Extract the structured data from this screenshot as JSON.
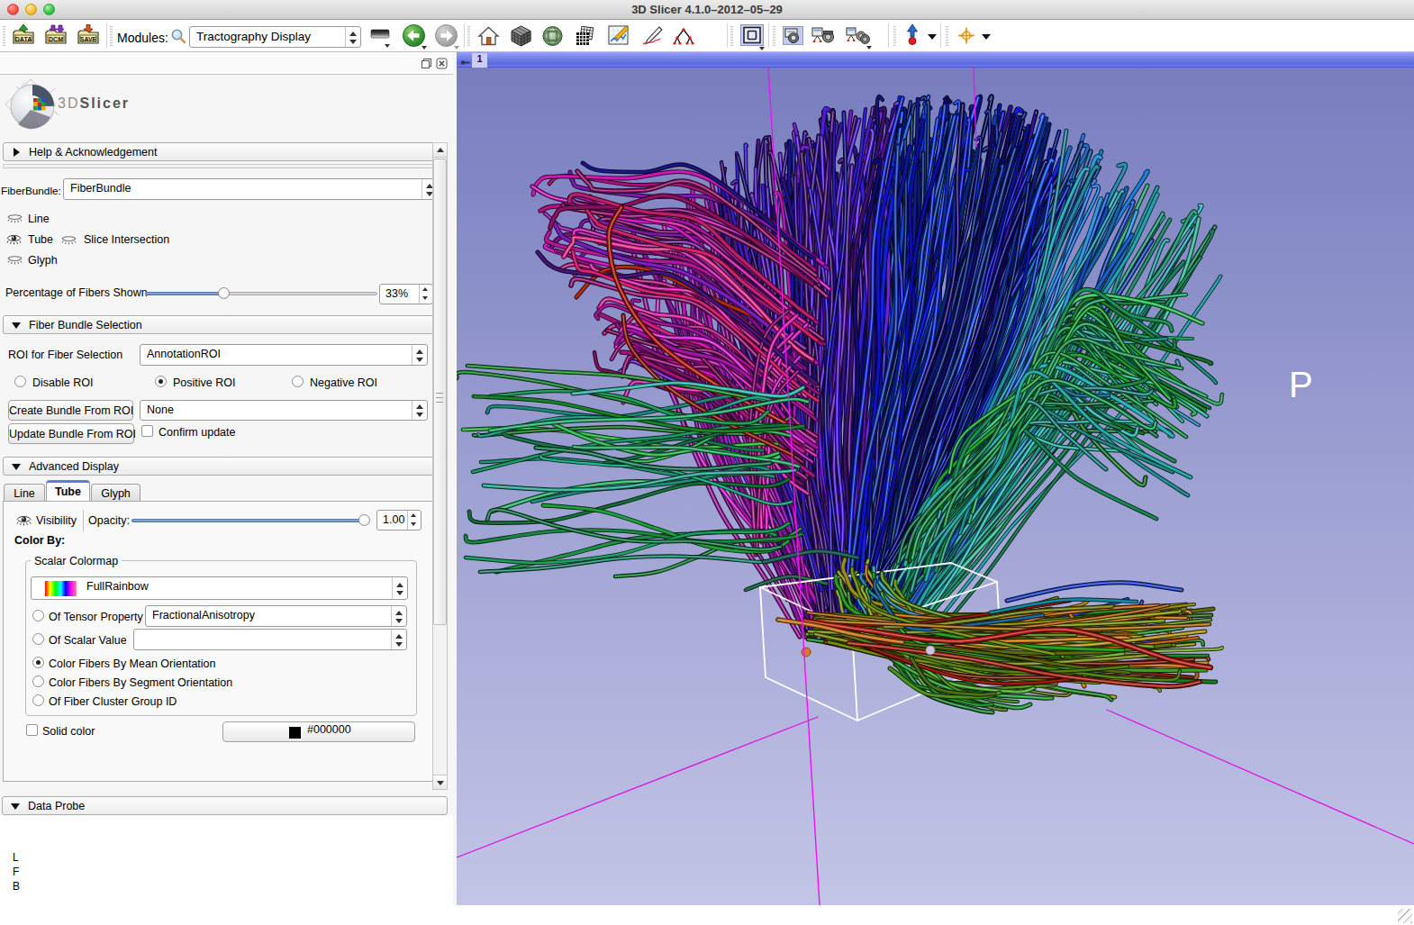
{
  "window": {
    "title": "3D Slicer 4.1.0–2012–05–29"
  },
  "toolbar": {
    "modules_label": "Modules:",
    "module_selector_value": "Tractography Display",
    "icons": [
      "load-data-icon",
      "load-dicom-icon",
      "save-icon",
      "search-icon",
      "module-history-icon",
      "module-back-icon",
      "module-forward-icon",
      "home-icon",
      "volumes-icon",
      "models-icon",
      "slices-icon",
      "chart-icon",
      "annotate-icon",
      "transforms-icon",
      "layout-icon",
      "screenshot-icon",
      "scene-view-icon",
      "scene-view-restore-icon",
      "fiducial-icon",
      "crosshair-icon"
    ],
    "data_icon_label": "DATA",
    "dcm_icon_label": "DCM",
    "save_icon_label": "SAVE"
  },
  "panel": {
    "logo_3d": "3D",
    "logo_slicer": "Slicer",
    "help_header": "Help & Acknowledgement",
    "fiberbundle_label": "FiberBundle:",
    "fiberbundle_value": "FiberBundle",
    "line_label": "Line",
    "tube_label": "Tube",
    "slice_intersection_label": "Slice Intersection",
    "glyph_label": "Glyph",
    "percentage_label": "Percentage of Fibers Shown",
    "percentage_value": "33%",
    "selection": {
      "header": "Fiber Bundle Selection",
      "roi_label": "ROI for Fiber Selection",
      "roi_value": "AnnotationROI",
      "disable_roi_label": "Disable ROI",
      "positive_roi_label": "Positive ROI",
      "negative_roi_label": "Negative ROI",
      "create_button": "Create Bundle From ROI",
      "create_value": "None",
      "update_button": "Update Bundle From ROI",
      "confirm_update_label": "Confirm update"
    },
    "advanced": {
      "header": "Advanced Display",
      "tabs": [
        "Line",
        "Tube",
        "Glyph"
      ],
      "active_tab": "Tube",
      "visibility_label": "Visibility",
      "opacity_label": "Opacity:",
      "opacity_value": "1.00",
      "color_by_label": "Color By:",
      "group_label": "Scalar Colormap",
      "colormap_value": "FullRainbow",
      "tensor_property_label": "Of Tensor Property",
      "tensor_property_value": "FractionalAnisotropy",
      "scalar_value_label": "Of Scalar Value",
      "scalar_value_value": "",
      "mean_orientation_label": "Color Fibers By Mean Orientation",
      "segment_orientation_label": "Color Fibers By Segment Orientation",
      "cluster_group_label": "Of Fiber Cluster Group ID",
      "solid_color_label": "Solid color",
      "solid_color_value": "#000000"
    },
    "data_probe_header": "Data Probe",
    "probe_rows": [
      "L",
      "F",
      "B"
    ]
  },
  "view": {
    "tab_label": "1",
    "orientation_letter": "P",
    "background_top": "#787dbf",
    "background_bottom": "#c3c5e6",
    "crosshair_color": "#f011f0",
    "roi_box_color": "#ffffff"
  }
}
